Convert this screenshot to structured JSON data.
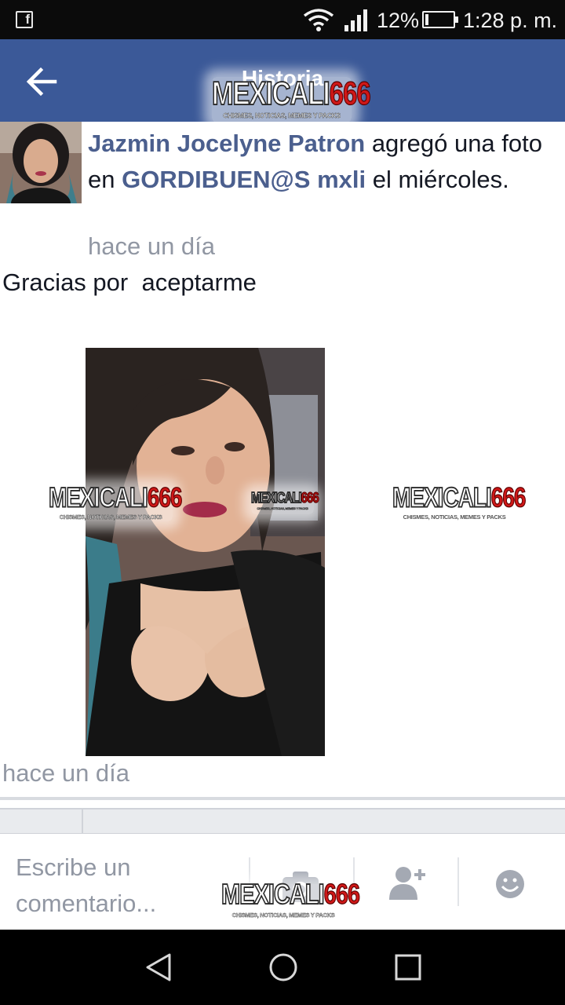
{
  "status_bar": {
    "battery_percent": "12%",
    "battery_level": 0.12,
    "time": "1:28 p. m.",
    "icons": [
      "facebook-notification-icon",
      "wifi-icon",
      "signal-icon",
      "battery-icon"
    ]
  },
  "header": {
    "title": "Historia",
    "back_icon": "arrow-left-icon"
  },
  "watermark": {
    "brand_white": "MEXICALI",
    "brand_red": "666",
    "tagline": "CHISMES, NOTICIAS, MEMES Y PACKS"
  },
  "post": {
    "author": "Jazmin Jocelyne Patron",
    "action_text": "agregó una foto en",
    "group": "GORDIBUEN@S mxli",
    "suffix": "el miércoles.",
    "time": "hace un día",
    "text": "Gracias por  aceptarme",
    "photo_time": "hace un día"
  },
  "comment_bar": {
    "placeholder": "Escribe un comentario...",
    "icons": [
      "camera-icon",
      "add-friend-icon",
      "emoji-icon"
    ]
  },
  "nav_bar": {
    "icons": [
      "back-triangle-icon",
      "home-circle-icon",
      "recents-square-icon"
    ]
  },
  "colors": {
    "brand_blue": "#3b5998",
    "link_blue": "#4b5f8e",
    "secondary_gray": "#9197a3",
    "watermark_red": "#d01818"
  }
}
